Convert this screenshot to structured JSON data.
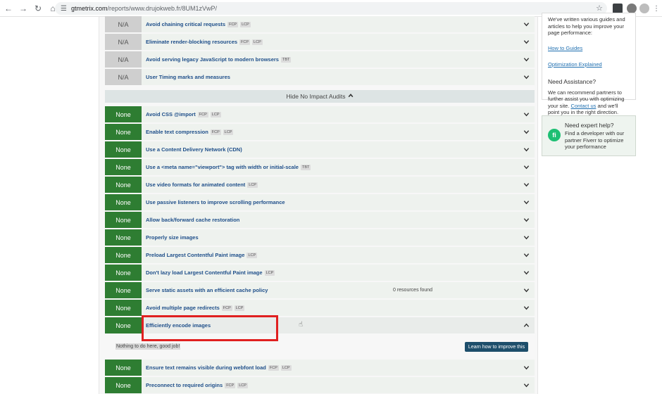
{
  "browser": {
    "url_host": "gtmetrix.com",
    "url_path": "/reports/www.drujokweb.fr/8UM1zVwP/"
  },
  "audits_top": [
    {
      "status": "N/A",
      "title": "Avoid chaining critical requests",
      "tags": [
        "FCP",
        "LCP"
      ]
    },
    {
      "status": "N/A",
      "title": "Eliminate render-blocking resources",
      "tags": [
        "FCP",
        "LCP"
      ]
    },
    {
      "status": "N/A",
      "title": "Avoid serving legacy JavaScript to modern browsers",
      "tags": [
        "TBT"
      ]
    },
    {
      "status": "N/A",
      "title": "User Timing marks and measures",
      "tags": []
    }
  ],
  "hide_bar_label": "Hide No Impact Audits",
  "audits_none": [
    {
      "status": "None",
      "title": "Avoid CSS @import",
      "tags": [
        "FCP",
        "LCP"
      ],
      "note": ""
    },
    {
      "status": "None",
      "title": "Enable text compression",
      "tags": [
        "FCP",
        "LCP"
      ],
      "note": ""
    },
    {
      "status": "None",
      "title": "Use a Content Delivery Network (CDN)",
      "tags": [],
      "note": ""
    },
    {
      "status": "None",
      "title": "Use a <meta name=\"viewport\"> tag with width or initial-scale",
      "tags": [
        "TBT"
      ],
      "note": ""
    },
    {
      "status": "None",
      "title": "Use video formats for animated content",
      "tags": [
        "LCP"
      ],
      "note": ""
    },
    {
      "status": "None",
      "title": "Use passive listeners to improve scrolling performance",
      "tags": [],
      "note": ""
    },
    {
      "status": "None",
      "title": "Allow back/forward cache restoration",
      "tags": [],
      "note": ""
    },
    {
      "status": "None",
      "title": "Properly size images",
      "tags": [],
      "note": ""
    },
    {
      "status": "None",
      "title": "Preload Largest Contentful Paint image",
      "tags": [
        "LCP"
      ],
      "note": ""
    },
    {
      "status": "None",
      "title": "Don't lazy load Largest Contentful Paint image",
      "tags": [
        "LCP"
      ],
      "note": ""
    },
    {
      "status": "None",
      "title": "Serve static assets with an efficient cache policy",
      "tags": [],
      "note": "0 resources found"
    },
    {
      "status": "None",
      "title": "Avoid multiple page redirects",
      "tags": [
        "FCP",
        "LCP"
      ],
      "note": ""
    },
    {
      "status": "None",
      "title": "Efficiently encode images",
      "tags": [],
      "note": "",
      "expanded": true
    }
  ],
  "expanded_panel": {
    "message": "Nothing to do here, good job!",
    "button": "Learn how to improve this"
  },
  "audits_bottom": [
    {
      "status": "None",
      "title": "Ensure text remains visible during webfont load",
      "tags": [
        "FCP",
        "LCP"
      ]
    },
    {
      "status": "None",
      "title": "Preconnect to required origins",
      "tags": [
        "FCP",
        "LCP"
      ]
    }
  ],
  "sidebar": {
    "guides_text": "We've written various guides and articles to help you improve your page performance:",
    "link_guides": "How to Guides",
    "link_optimization": "Optimization Explained",
    "assist_heading": "Need Assistance?",
    "assist_text_before": "We can recommend partners to further assist you with optimizing your site.",
    "assist_link": "Contact us",
    "assist_text_after": "and we'll point you in the right direction.",
    "fiverr_heading": "Need expert help?",
    "fiverr_text": "Find a developer with our partner Fiverr to optimize your performance",
    "fiverr_icon": "fi"
  },
  "colors": {
    "none_badge": "#2e7d32",
    "na_badge": "#cfcfcf",
    "title_link": "#1f4f8a",
    "highlight": "#e02020",
    "learn_button": "#1d4e6b"
  }
}
